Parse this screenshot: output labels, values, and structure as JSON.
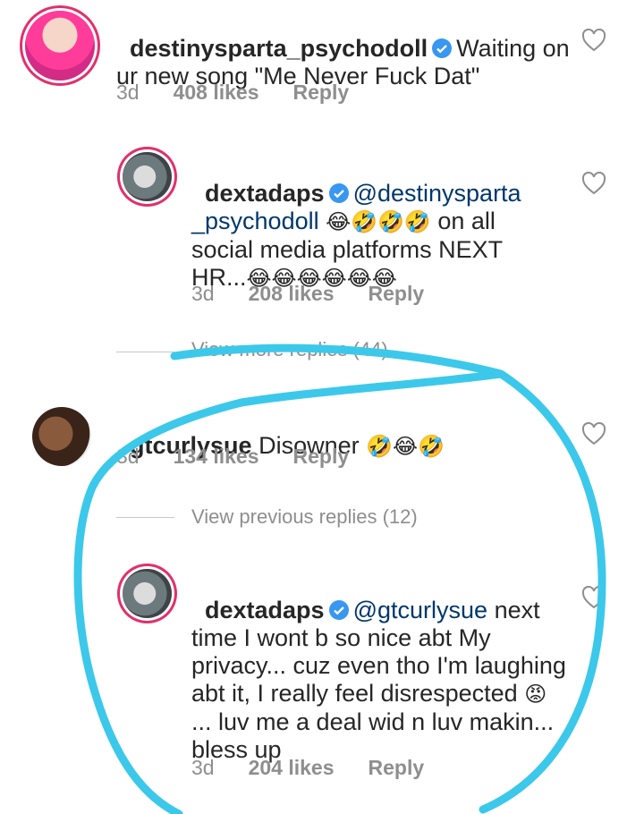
{
  "comments": [
    {
      "username": "destinysparta_psychodoll",
      "text": "Waiting on ur new song \"Me Never Fuck Dat\"",
      "time": "3d",
      "likes": "408 likes",
      "reply": "Reply"
    },
    {
      "username": "dextadaps",
      "mention": "@destinysparta _psychodoll",
      "text": "on all social media platforms NEXT HR...",
      "emojis1": "😂🤣🤣🤣",
      "emojis2": "😂😂😂😂😂😂",
      "time": "3d",
      "likes": "208 likes",
      "reply": "Reply"
    },
    {
      "username": "gtcurlysue",
      "text": "Disowner",
      "emojis": "🤣😂🤣",
      "time": "3d",
      "likes": "134 likes",
      "reply": "Reply"
    },
    {
      "username": "dextadaps",
      "mention": "@gtcurlysue",
      "text": "next time I wont b so nice abt My privacy... cuz even tho I'm laughing abt it, I really feel disrespected",
      "emoji": "😡",
      "text2": "... luv me a deal wid n luv makin... bless up",
      "time": "3d",
      "likes": "204 likes",
      "reply": "Reply"
    }
  ],
  "view_more": "View more replies (44)",
  "view_previous": "View previous replies (12)",
  "annotation_color": "#3cc8ea"
}
